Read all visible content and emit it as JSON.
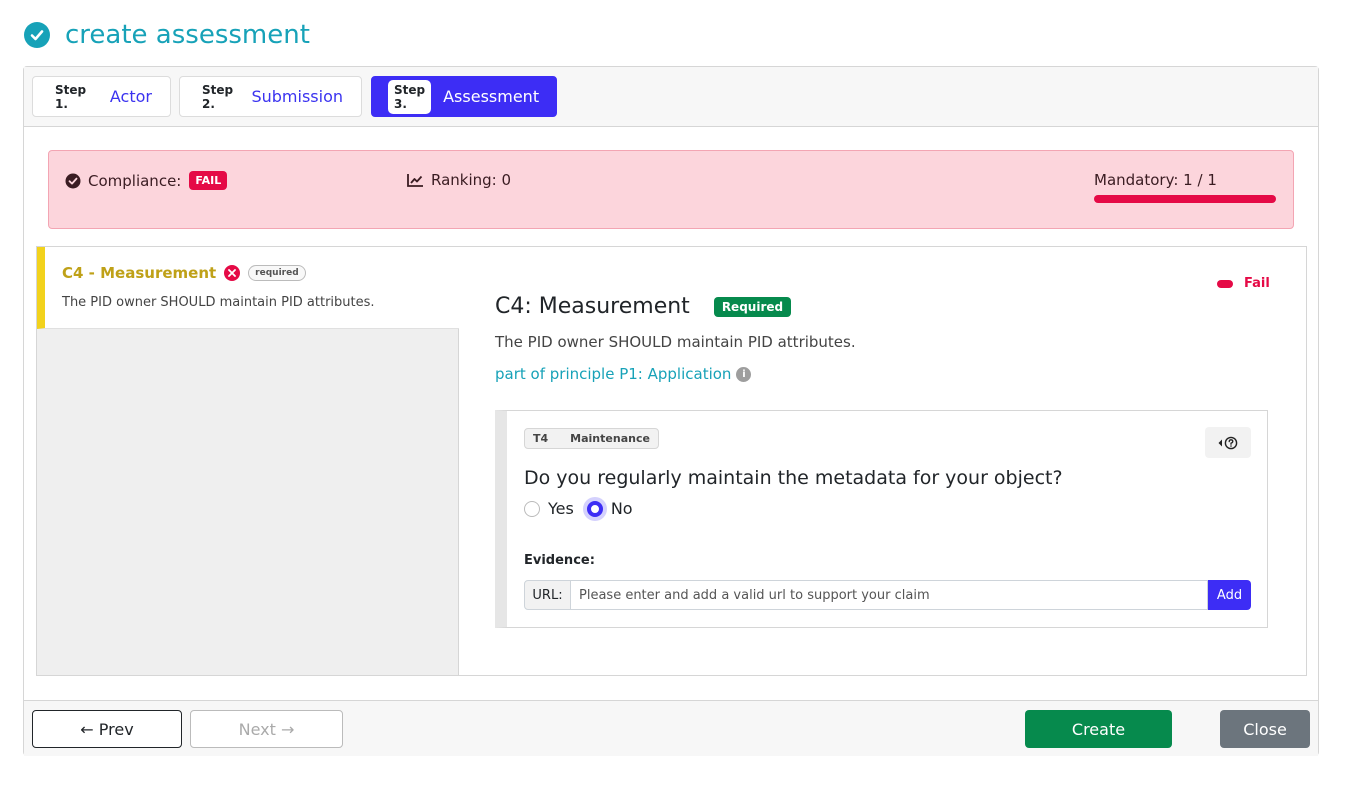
{
  "page": {
    "title": "create assessment"
  },
  "steps": [
    {
      "num": "Step 1.",
      "label": "Actor"
    },
    {
      "num": "Step 2.",
      "label": "Submission"
    },
    {
      "num": "Step 3.",
      "label": "Assessment"
    }
  ],
  "summary": {
    "compliance_label": "Compliance:",
    "compliance_badge": "FAIL",
    "ranking": "Ranking: 0",
    "mandatory": "Mandatory: 1 / 1",
    "mandatory_progress": 1.0
  },
  "criteria": [
    {
      "name": "C4 - Measurement",
      "badge": "required",
      "desc": "The PID owner SHOULD maintain PID attributes."
    }
  ],
  "detail": {
    "status": "Fail",
    "title": "C4: Measurement",
    "badge": "Required",
    "desc": "The PID owner SHOULD maintain PID attributes.",
    "principle": "part of principle P1: Application",
    "test": {
      "id": "T4",
      "name": "Maintenance",
      "question": "Do you regularly maintain the metadata for your object?",
      "options": [
        "Yes",
        "No"
      ],
      "selected": "No",
      "evidence_label": "Evidence:",
      "url_prefix": "URL:",
      "url_placeholder": "Please enter and add a valid url to support your claim",
      "add_label": "Add"
    }
  },
  "footer": {
    "prev": "← Prev",
    "next": "Next →",
    "create": "Create",
    "close": "Close"
  },
  "colors": {
    "accent": "#3d2df5",
    "fail": "#e50a46",
    "success": "#068a4d",
    "teal": "#17a2b8",
    "warning": "#f2d21c"
  }
}
